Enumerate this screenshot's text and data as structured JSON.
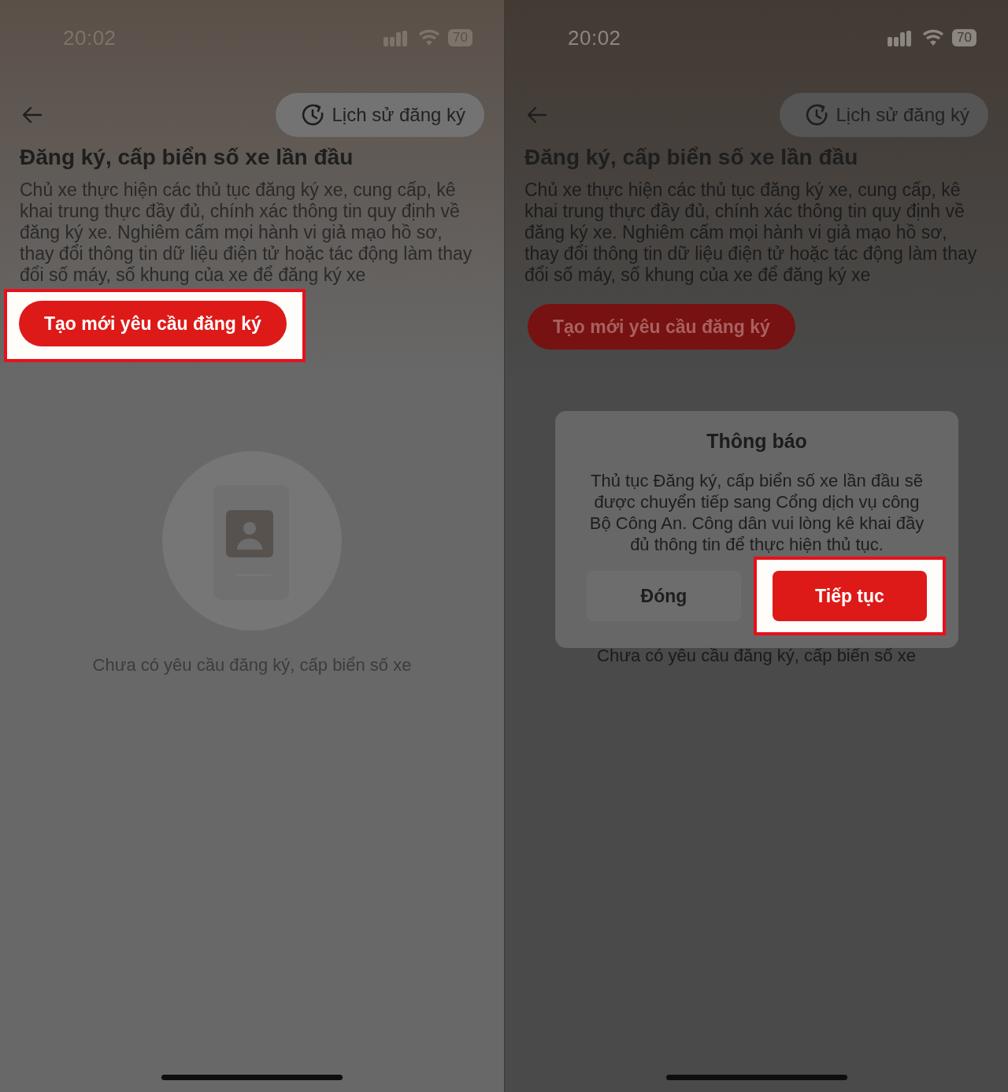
{
  "screens": [
    {
      "status_bar": {
        "time": "20:02",
        "battery": "70"
      },
      "history_button": {
        "label": "Lịch sử đăng ký"
      },
      "title": "Đăng ký, cấp biển số xe lần đầu",
      "description": "Chủ xe thực hiện các thủ tục đăng ký xe, cung cấp, kê khai trung thực đầy đủ, chính xác thông tin quy định về đăng ký xe. Nghiêm cấm mọi hành vi giả mạo hồ sơ, thay đổi thông tin dữ liệu điện tử hoặc tác động làm thay đổi số máy, số khung của xe để đăng ký xe",
      "create_button": {
        "label": "Tạo mới yêu cầu đăng ký",
        "highlighted": true
      },
      "empty_message": "Chưa có yêu cầu đăng ký, cấp biển số xe"
    },
    {
      "status_bar": {
        "time": "20:02",
        "battery": "70"
      },
      "history_button": {
        "label": "Lịch sử đăng ký"
      },
      "title": "Đăng ký, cấp biển số xe lần đầu",
      "description": "Chủ xe thực hiện các thủ tục đăng ký xe, cung cấp, kê khai trung thực đầy đủ, chính xác thông tin quy định về đăng ký xe. Nghiêm cấm mọi hành vi giả mạo hồ sơ, thay đổi thông tin dữ liệu điện tử hoặc tác động làm thay đổi số máy, số khung của xe để đăng ký xe",
      "create_button": {
        "label": "Tạo mới yêu cầu đăng ký",
        "highlighted": false
      },
      "empty_message": "Chưa có yêu cầu đăng ký, cấp biển số xe",
      "dialog": {
        "title": "Thông báo",
        "message": "Thủ tục Đăng ký, cấp biển số xe lần đầu sẽ được chuyển tiếp sang Cổng dịch vụ công Bộ Công An. Công dân vui lòng kê khai đầy đủ thông tin để thực hiện thủ tục.",
        "buttons": [
          {
            "label": "Đóng",
            "kind": "secondary",
            "highlighted": false
          },
          {
            "label": "Tiếp tục",
            "kind": "primary",
            "highlighted": true
          }
        ]
      }
    }
  ]
}
